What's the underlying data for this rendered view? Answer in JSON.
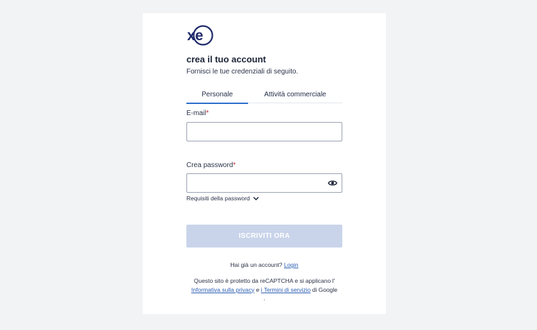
{
  "brand": {
    "logo_text": "xe",
    "accent_color": "#1f2a6b",
    "link_color": "#2d5fb4",
    "tab_active_color": "#2d6fcc",
    "button_disabled_color": "#c9d4ea"
  },
  "header": {
    "title": "crea il tuo account",
    "subtitle": "Fornisci le tue credenziali di seguito."
  },
  "tabs": [
    {
      "label": "Personale",
      "active": true
    },
    {
      "label": "Attività commerciale",
      "active": false
    }
  ],
  "form": {
    "email": {
      "label": "E-mail",
      "required_mark": "*",
      "value": "",
      "placeholder": ""
    },
    "password": {
      "label": "Crea password",
      "required_mark": "*",
      "value": "",
      "placeholder": "",
      "toggle_icon": "eye-icon"
    },
    "password_requirements": {
      "label": "Requisiti della password",
      "icon": "chevron-down-icon"
    },
    "submit_label": "ISCRIVITI ORA"
  },
  "footer": {
    "login_prompt": "Hai già un account?",
    "login_link": "Login",
    "captcha_text": "Questo sito è protetto da reCAPTCHA e si applicano l'",
    "privacy_link": "Informativa sulla privacy",
    "and": "e",
    "terms_link": "i Termini di servizio",
    "google_suffix": "di Google",
    "trailing": "."
  }
}
